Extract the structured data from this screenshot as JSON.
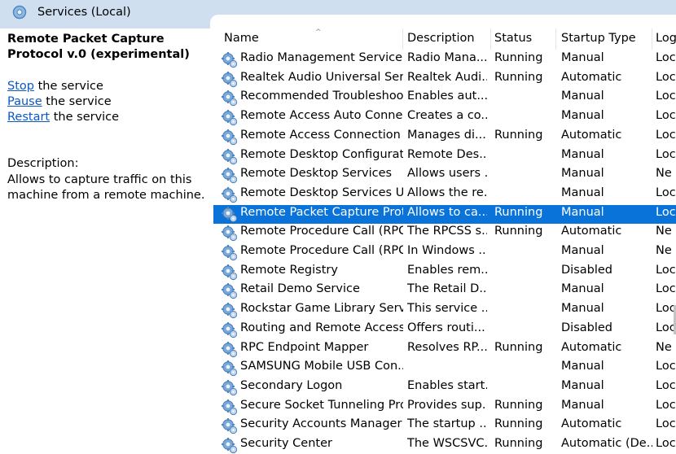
{
  "window": {
    "title": "Services (Local)"
  },
  "icons": {
    "title": "services-gear-icon",
    "row": "service-gear-icon"
  },
  "colors": {
    "header_band": "#cfdff0",
    "selection": "#0a73d9",
    "link": "#0b57c3"
  },
  "left_panel": {
    "service_name": "Remote Packet Capture Protocol v.0 (experimental)",
    "actions": [
      {
        "link": "Stop",
        "rest": " the service"
      },
      {
        "link": "Pause",
        "rest": " the service"
      },
      {
        "link": "Restart",
        "rest": " the service"
      }
    ],
    "description_label": "Description:",
    "description_text": "Allows to capture traffic on this machine from a remote machine."
  },
  "list": {
    "columns": {
      "name": "Name",
      "description": "Description",
      "status": "Status",
      "startup": "Startup Type",
      "logon": "Log"
    },
    "sort_indicator": "^",
    "rows": [
      {
        "name": "Radio Management Service",
        "description": "Radio Mana...",
        "status": "Running",
        "startup": "Manual",
        "logon": "Loc"
      },
      {
        "name": "Realtek Audio Universal Serv...",
        "description": "Realtek Audi...",
        "status": "Running",
        "startup": "Automatic",
        "logon": "Loc"
      },
      {
        "name": "Recommended Troubleshoo...",
        "description": "Enables aut...",
        "status": "",
        "startup": "Manual",
        "logon": "Loc"
      },
      {
        "name": "Remote Access Auto Connec...",
        "description": "Creates a co...",
        "status": "",
        "startup": "Manual",
        "logon": "Loc"
      },
      {
        "name": "Remote Access Connection ...",
        "description": "Manages di...",
        "status": "Running",
        "startup": "Automatic",
        "logon": "Loc"
      },
      {
        "name": "Remote Desktop Configurati...",
        "description": "Remote Des...",
        "status": "",
        "startup": "Manual",
        "logon": "Loc"
      },
      {
        "name": "Remote Desktop Services",
        "description": "Allows users ...",
        "status": "",
        "startup": "Manual",
        "logon": "Ne"
      },
      {
        "name": "Remote Desktop Services Us...",
        "description": "Allows the re...",
        "status": "",
        "startup": "Manual",
        "logon": "Loc"
      },
      {
        "name": "Remote Packet Capture Prot...",
        "description": "Allows to ca...",
        "status": "Running",
        "startup": "Manual",
        "logon": "Loc",
        "selected": true
      },
      {
        "name": "Remote Procedure Call (RPC)",
        "description": "The RPCSS s...",
        "status": "Running",
        "startup": "Automatic",
        "logon": "Ne"
      },
      {
        "name": "Remote Procedure Call (RPC)...",
        "description": "In Windows ...",
        "status": "",
        "startup": "Manual",
        "logon": "Ne"
      },
      {
        "name": "Remote Registry",
        "description": "Enables rem...",
        "status": "",
        "startup": "Disabled",
        "logon": "Loc"
      },
      {
        "name": "Retail Demo Service",
        "description": "The Retail D...",
        "status": "",
        "startup": "Manual",
        "logon": "Loc"
      },
      {
        "name": "Rockstar Game Library Service",
        "description": "This service ...",
        "status": "",
        "startup": "Manual",
        "logon": "Loc"
      },
      {
        "name": "Routing and Remote Access",
        "description": "Offers routi...",
        "status": "",
        "startup": "Disabled",
        "logon": "Loc"
      },
      {
        "name": "RPC Endpoint Mapper",
        "description": "Resolves RP...",
        "status": "Running",
        "startup": "Automatic",
        "logon": "Ne"
      },
      {
        "name": "SAMSUNG Mobile USB Con...",
        "description": "",
        "status": "",
        "startup": "Manual",
        "logon": "Loc"
      },
      {
        "name": "Secondary Logon",
        "description": "Enables start...",
        "status": "",
        "startup": "Manual",
        "logon": "Loc"
      },
      {
        "name": "Secure Socket Tunneling Pro...",
        "description": "Provides sup...",
        "status": "Running",
        "startup": "Manual",
        "logon": "Loc"
      },
      {
        "name": "Security Accounts Manager",
        "description": "The startup ...",
        "status": "Running",
        "startup": "Automatic",
        "logon": "Loc"
      },
      {
        "name": "Security Center",
        "description": "The WSCSVC...",
        "status": "Running",
        "startup": "Automatic (De...",
        "logon": "Loc"
      }
    ]
  }
}
